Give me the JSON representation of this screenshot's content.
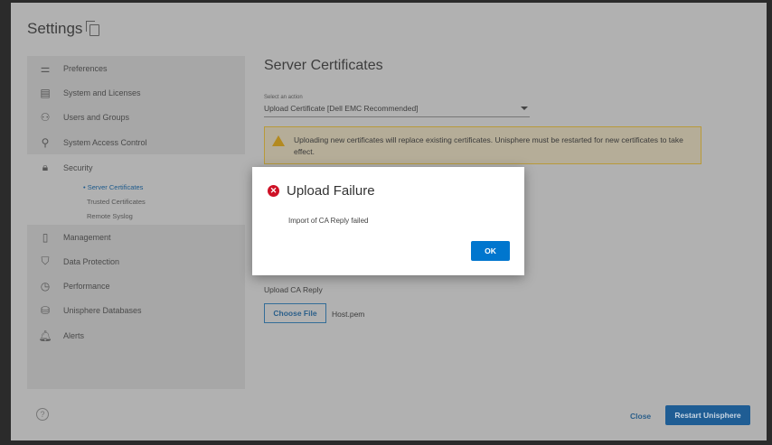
{
  "window": {
    "title": "Settings"
  },
  "sidebar": {
    "items": [
      {
        "label": "Preferences",
        "icon": "sliders-icon"
      },
      {
        "label": "System and Licenses",
        "icon": "license-icon"
      },
      {
        "label": "Users and Groups",
        "icon": "users-icon"
      },
      {
        "label": "System Access Control",
        "icon": "key-icon"
      },
      {
        "label": "Security",
        "icon": "lock-icon"
      },
      {
        "label": "Management",
        "icon": "server-icon"
      },
      {
        "label": "Data Protection",
        "icon": "shield-icon"
      },
      {
        "label": "Performance",
        "icon": "gauge-icon"
      },
      {
        "label": "Unisphere Databases",
        "icon": "database-icon"
      },
      {
        "label": "Alerts",
        "icon": "bell-icon"
      }
    ],
    "security_sub": [
      "Server Certificates",
      "Trusted Certificates",
      "Remote Syslog"
    ]
  },
  "main": {
    "heading": "Server Certificates",
    "select_label": "Select an action",
    "select_value": "Upload Certificate [Dell EMC Recommended]",
    "warning": "Uploading new certificates will replace existing certificates. Unisphere must be restarted for new certificates to take effect.",
    "upload_label": "Upload CA Reply",
    "choose_file": "Choose File",
    "file_name": "Host.pem"
  },
  "footer": {
    "help": "?",
    "close": "Close",
    "restart": "Restart Unisphere"
  },
  "dialog": {
    "title": "Upload Failure",
    "message": "Import of CA Reply failed",
    "ok": "OK",
    "colors": {
      "error": "#ce1126",
      "primary": "#0076ce"
    }
  }
}
